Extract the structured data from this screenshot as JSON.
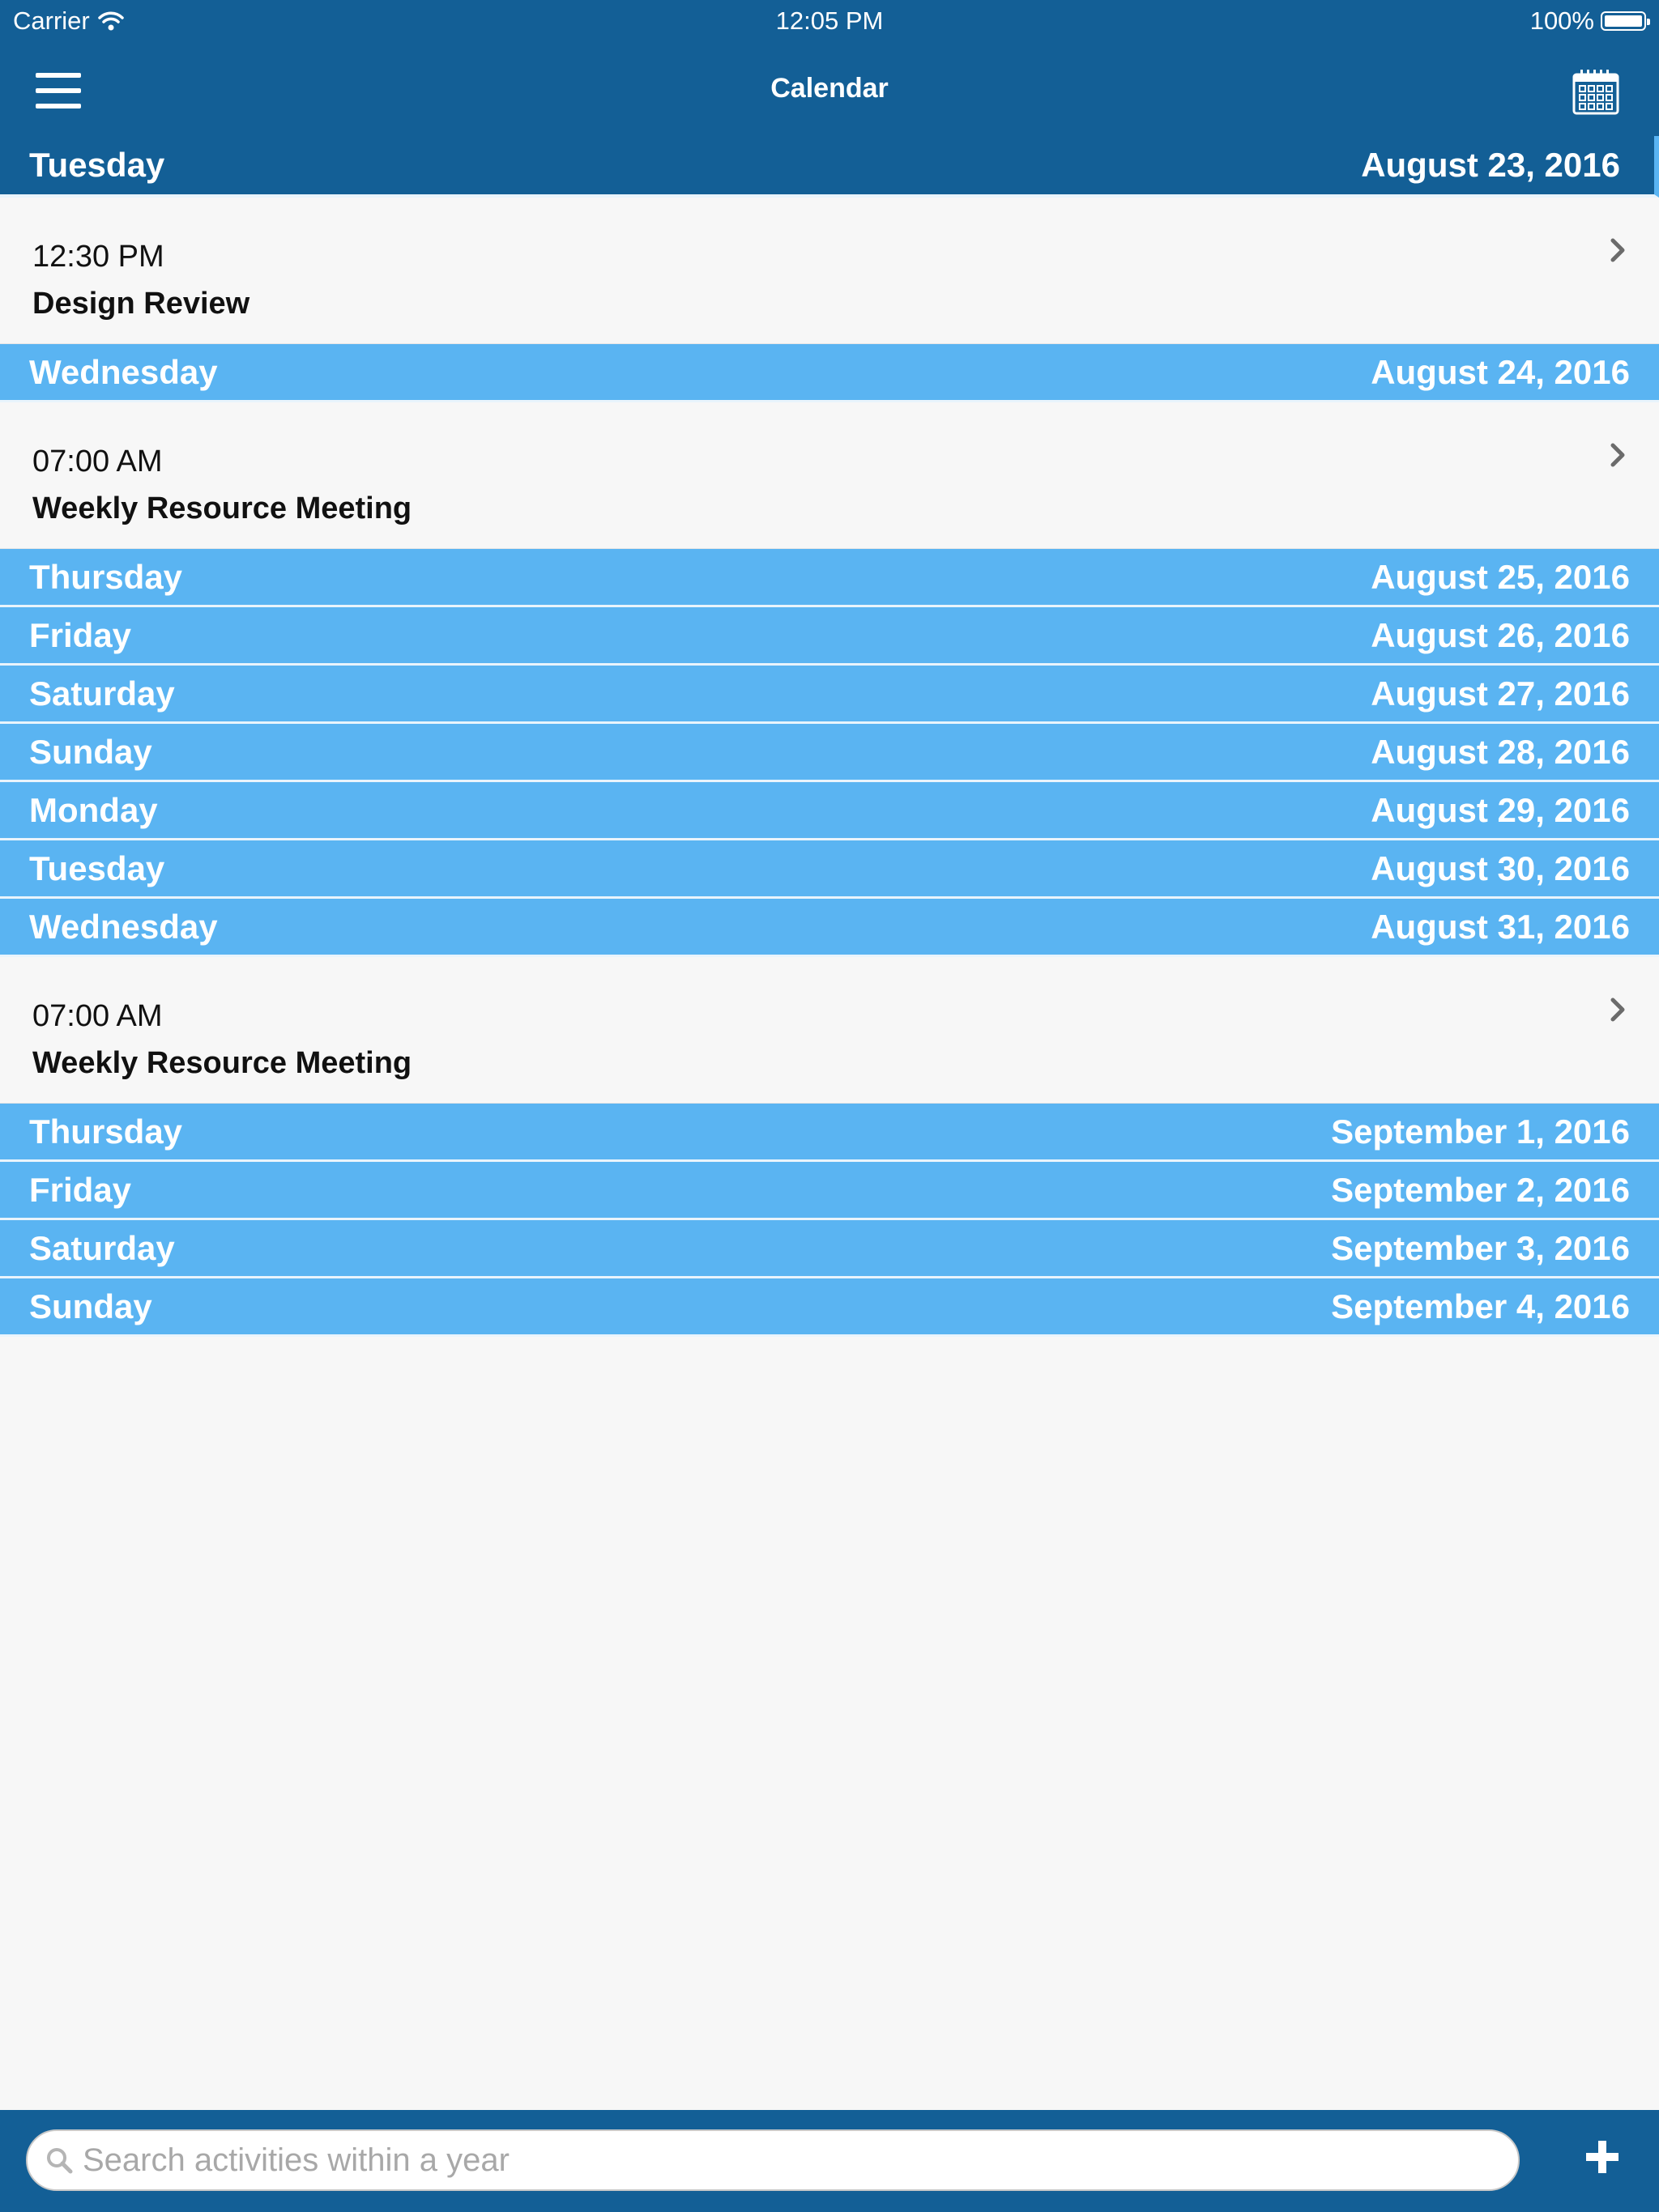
{
  "status_bar": {
    "carrier": "Carrier",
    "time": "12:05 PM",
    "battery": "100%"
  },
  "nav": {
    "title": "Calendar"
  },
  "days": [
    {
      "weekday": "Tuesday",
      "date": "August 23, 2016",
      "current": true,
      "events": [
        {
          "time": "12:30 PM",
          "title": "Design Review"
        }
      ]
    },
    {
      "weekday": "Wednesday",
      "date": "August 24, 2016",
      "events": [
        {
          "time": "07:00 AM",
          "title": "Weekly Resource Meeting"
        }
      ]
    },
    {
      "weekday": "Thursday",
      "date": "August 25, 2016",
      "events": []
    },
    {
      "weekday": "Friday",
      "date": "August 26, 2016",
      "events": []
    },
    {
      "weekday": "Saturday",
      "date": "August 27, 2016",
      "events": []
    },
    {
      "weekday": "Sunday",
      "date": "August 28, 2016",
      "events": []
    },
    {
      "weekday": "Monday",
      "date": "August 29, 2016",
      "events": []
    },
    {
      "weekday": "Tuesday",
      "date": "August 30, 2016",
      "events": []
    },
    {
      "weekday": "Wednesday",
      "date": "August 31, 2016",
      "events": [
        {
          "time": "07:00 AM",
          "title": "Weekly Resource Meeting"
        }
      ]
    },
    {
      "weekday": "Thursday",
      "date": "September 1, 2016",
      "events": []
    },
    {
      "weekday": "Friday",
      "date": "September 2, 2016",
      "events": []
    },
    {
      "weekday": "Saturday",
      "date": "September 3, 2016",
      "events": []
    },
    {
      "weekday": "Sunday",
      "date": "September 4, 2016",
      "events": []
    }
  ],
  "search": {
    "placeholder": "Search activities within a year",
    "value": ""
  },
  "icons": {
    "menu": "hamburger-menu-icon",
    "calendar": "calendar-icon",
    "chevron": "chevron-right-icon",
    "search": "search-icon",
    "add": "plus-icon",
    "wifi": "wifi-icon",
    "battery": "battery-icon"
  },
  "colors": {
    "nav_background": "#135f96",
    "day_header": "#5ab4f2",
    "current_day_header": "#135f96",
    "list_background": "#f7f7f7"
  }
}
